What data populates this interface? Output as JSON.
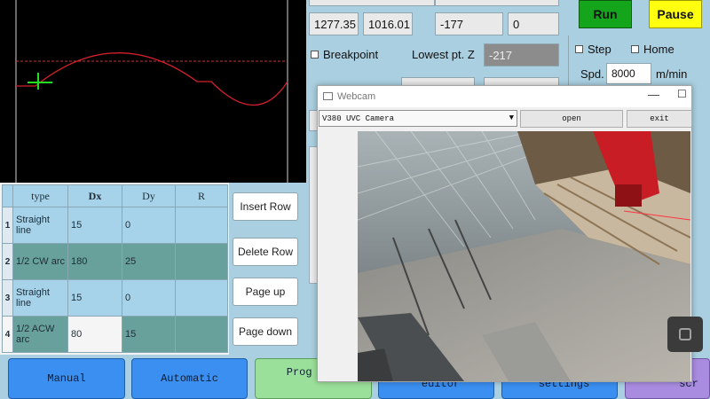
{
  "table": {
    "headers": [
      "type",
      "Dx",
      "Dy",
      "R"
    ],
    "rows": [
      {
        "idx": "1",
        "type": "Straight line",
        "dx": "15",
        "dy": "0",
        "r": ""
      },
      {
        "idx": "2",
        "type": "1/2 CW arc",
        "dx": "180",
        "dy": "25",
        "r": ""
      },
      {
        "idx": "3",
        "type": "Straight line",
        "dx": "15",
        "dy": "0",
        "r": ""
      },
      {
        "idx": "4",
        "type": "1/2 ACW arc",
        "dx": "80",
        "dy": "15",
        "r": ""
      }
    ]
  },
  "side_buttons": {
    "insert": "Insert Row",
    "delete": "Delete Row",
    "page_up": "Page up",
    "page_down": "Page down"
  },
  "coords": {
    "x": "1277.35",
    "y": "1016.01",
    "z": "-177",
    "a": "0"
  },
  "breakpoint_label": "Breakpoint",
  "lowest_label": "Lowest pt. Z",
  "lowest_value": "-217",
  "run_label": "Run",
  "pause_label": "Pause",
  "step_label": "Step",
  "home_label": "Home",
  "speed": {
    "label": "Spd.",
    "value": "8000",
    "unit": "m/min"
  },
  "nav": {
    "manual": "Manual",
    "automatic": "Automatic",
    "prog_editing": "Prog editing",
    "editor": "editor",
    "settings": "settings",
    "scr": "scr"
  },
  "webcam": {
    "title": "Webcam",
    "minimize": "—",
    "maximize": "☐",
    "camera": "V380 UVC Camera",
    "open": "open",
    "exit": "exit"
  },
  "colors": {
    "run": "#14a51c",
    "pause": "#ffff10",
    "nav": "#3a8ff0",
    "active_nav": "#9be09a",
    "path": "#d0202a",
    "cursor": "#22dd22"
  }
}
